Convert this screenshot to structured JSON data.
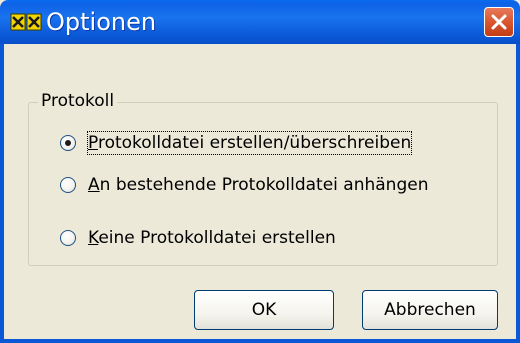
{
  "window": {
    "title": "Optionen",
    "title_icon": "options-icon",
    "close_icon": "close-icon",
    "titlebar_color": "#0b58d6",
    "close_color": "#d9562e"
  },
  "group": {
    "label": "Protokoll",
    "options": [
      {
        "label": "Protokolldatei erstellen/überschreiben",
        "access_key": "P",
        "selected": true
      },
      {
        "label": "An bestehende Protokolldatei anhängen",
        "access_key": "A",
        "selected": false
      },
      {
        "label": "Keine Protokolldatei erstellen",
        "access_key": "K",
        "selected": false
      }
    ]
  },
  "buttons": {
    "ok_label": "OK",
    "cancel_label": "Abbrechen"
  }
}
